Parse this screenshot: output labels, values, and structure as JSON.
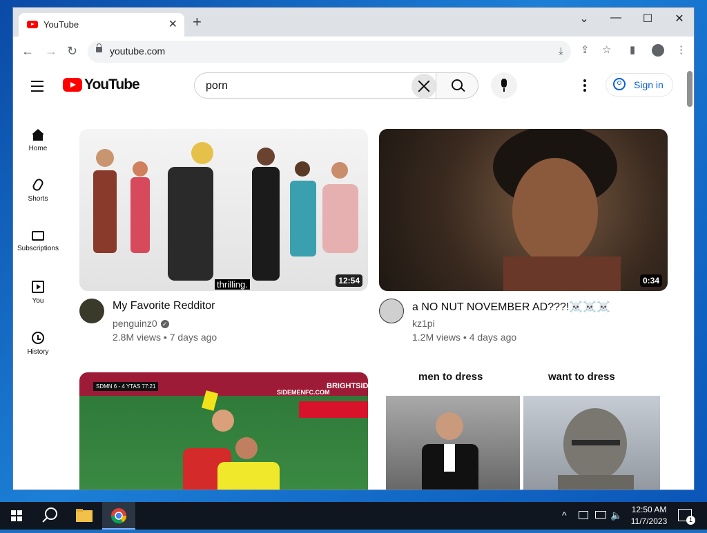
{
  "browser": {
    "tab_title": "YouTube",
    "tab_close": "✕",
    "new_tab": "+",
    "url": "youtube.com",
    "win_dropdown": "⌄",
    "win_minimize": "—",
    "win_maximize": "☐",
    "win_close": "✕",
    "back": "←",
    "forward": "→",
    "reload": "↻"
  },
  "youtube": {
    "logo_text": "YouTube",
    "search_value": "porn",
    "sign_in": "Sign in",
    "sidebar": [
      {
        "label": "Home"
      },
      {
        "label": "Shorts"
      },
      {
        "label": "Subscriptions"
      },
      {
        "label": "You"
      },
      {
        "label": "History"
      }
    ],
    "videos": [
      {
        "title": "My Favorite Redditor",
        "channel": "penguinz0",
        "meta": "2.8M views • 7 days ago",
        "duration": "12:54",
        "caption": "thrilling."
      },
      {
        "title": "a NO NUT NOVEMBER AD???!☠️☠️☠️",
        "channel": "kz1pi",
        "meta": "1.2M views • 4 days ago",
        "duration": "0:34"
      },
      {
        "scoreboard": "SDMN 6 - 4 YTAS 77:21",
        "banner": "SIDEMENFC.COM",
        "sponsor": "BRIGHTSIDE"
      },
      {
        "left_caption": "men to dress",
        "right_caption": "want to dress"
      }
    ]
  },
  "taskbar": {
    "time": "12:50 AM",
    "date": "11/7/2023",
    "notifications": "1"
  },
  "colors": {
    "yt_red": "#ff0000",
    "link_blue": "#065fd4",
    "taskbar": "#0f1620"
  }
}
